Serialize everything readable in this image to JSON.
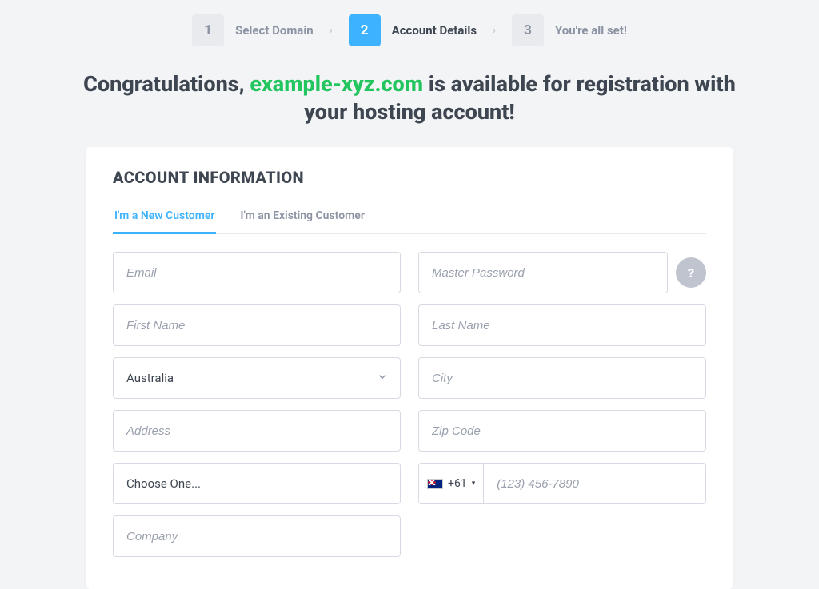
{
  "stepper": {
    "steps": [
      {
        "num": "1",
        "label": "Select Domain"
      },
      {
        "num": "2",
        "label": "Account Details"
      },
      {
        "num": "3",
        "label": "You're all set!"
      }
    ]
  },
  "headline": {
    "pre": "Congratulations, ",
    "domain": "example-xyz.com",
    "post": " is available for registration with your hosting account!"
  },
  "section_title": "ACCOUNT INFORMATION",
  "tabs": {
    "new": "I'm a New Customer",
    "existing": "I'm an Existing Customer"
  },
  "fields": {
    "email_ph": "Email",
    "password_ph": "Master Password",
    "help_icon": "?",
    "first_name_ph": "First Name",
    "last_name_ph": "Last Name",
    "country_value": "Australia",
    "city_ph": "City",
    "address_ph": "Address",
    "zip_ph": "Zip Code",
    "state_value": "Choose One...",
    "phone_code": "+61",
    "phone_caret": "▾",
    "phone_ph": "(123) 456-7890",
    "company_ph": "Company"
  }
}
